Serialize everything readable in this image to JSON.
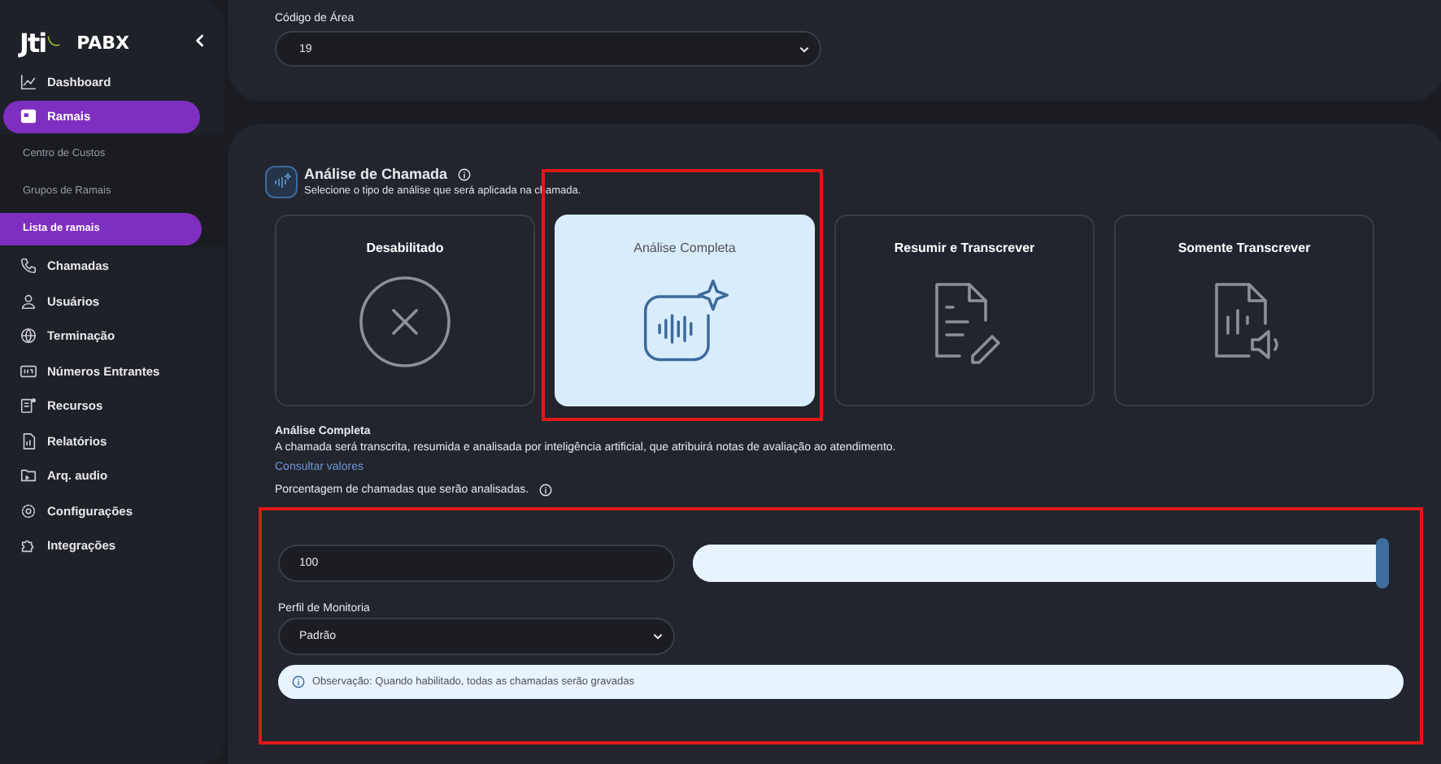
{
  "sidebar": {
    "logo": "Jti",
    "brand": "PABX",
    "items": [
      {
        "label": "Dashboard",
        "kind": "item",
        "selected": false
      },
      {
        "label": "Ramais",
        "kind": "item",
        "selected": true
      },
      {
        "label": "Centro de Custos",
        "kind": "subitem",
        "selected": false
      },
      {
        "label": "Grupos de Ramais",
        "kind": "subitem",
        "selected": false
      },
      {
        "label": "Lista de ramais",
        "kind": "subitem",
        "selected": true
      },
      {
        "label": "Chamadas",
        "kind": "item",
        "selected": false
      },
      {
        "label": "Usuários",
        "kind": "item",
        "selected": false
      },
      {
        "label": "Terminação",
        "kind": "item",
        "selected": false
      },
      {
        "label": "Números Entrantes",
        "kind": "item",
        "selected": false
      },
      {
        "label": "Recursos",
        "kind": "item",
        "selected": false
      },
      {
        "label": "Relatórios",
        "kind": "item",
        "selected": false
      },
      {
        "label": "Arq. audio",
        "kind": "item",
        "selected": false
      },
      {
        "label": "Configurações",
        "kind": "item",
        "selected": false
      },
      {
        "label": "Integrações",
        "kind": "item",
        "selected": false
      }
    ]
  },
  "area_code": {
    "label": "Código de Área",
    "value": "19"
  },
  "call_analysis": {
    "title": "Análise de Chamada",
    "subtitle": "Selecione o tipo de análise que será aplicada na chamada.",
    "options": [
      {
        "label": "Desabilitado",
        "kind": "disabled",
        "selected": false,
        "highlighted": false
      },
      {
        "label": "Análise Completa",
        "kind": "full",
        "selected": true,
        "highlighted": true
      },
      {
        "label": "Resumir e Transcrever",
        "kind": "summary",
        "selected": false,
        "highlighted": false
      },
      {
        "label": "Somente Transcrever",
        "kind": "transcribe",
        "selected": false,
        "highlighted": false
      }
    ],
    "description_title": "Análise Completa",
    "description": "A chamada será transcrita, resumida e analisada por inteligência artificial, que atribuirá notas de avaliação ao atendimento.",
    "link": "Consultar valores",
    "percentage_label": "Porcentagem de chamadas que serão analisadas.",
    "settings": {
      "highlighted": true,
      "percentage_value": "100",
      "slider": {
        "level": 1
      },
      "profile_label": "Perfil de Monitoria",
      "profile_value": "Padrão",
      "note": "Observação: Quando habilitado, todas as chamadas serão gravadas"
    }
  }
}
